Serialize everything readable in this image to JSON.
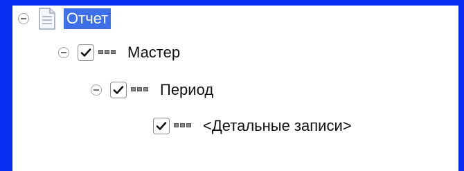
{
  "tree": {
    "root": {
      "label": "Отчет",
      "expanded": true,
      "selected": true,
      "icon": "report-document-icon"
    },
    "nodes": [
      {
        "label": "Мастер",
        "checked": true,
        "expanded": true,
        "icon": "grouping-icon"
      },
      {
        "label": "Период",
        "checked": true,
        "expanded": true,
        "icon": "grouping-icon"
      },
      {
        "label": "<Детальные записи>",
        "checked": true,
        "expanded": false,
        "icon": "grouping-icon"
      }
    ]
  },
  "colors": {
    "frame": "#0a2ef2",
    "selection": "#3c6fe8",
    "panel": "#ffffff",
    "text": "#111111"
  }
}
